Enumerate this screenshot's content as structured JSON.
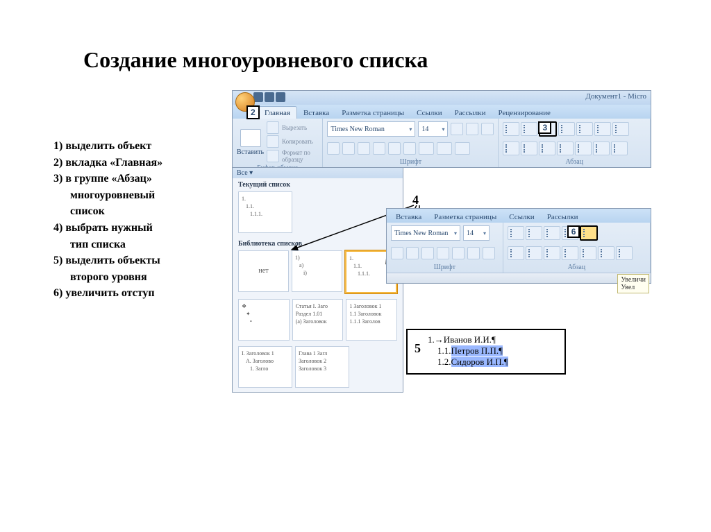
{
  "title": "Создание многоуровневого списка",
  "steps": {
    "s1": "1) выделить объект",
    "s2": "2) вкладка «Главная»",
    "s3": "3) в группе «Абзац»",
    "s3b": "многоуровневый",
    "s3c": "список",
    "s4": "4) выбрать нужный",
    "s4b": "тип списка",
    "s5": "5) выделить объекты",
    "s5b": "второго уровня",
    "s6": "6) увеличить отступ"
  },
  "ribbon": {
    "doc_title": "Документ1 - Micro",
    "tabs": {
      "home": "Главная",
      "insert": "Вставка",
      "layout": "Разметка страницы",
      "refs": "Ссылки",
      "mail": "Рассылки",
      "review": "Рецензирование"
    },
    "groups": {
      "clipboard": {
        "label": "Буфер обмена",
        "paste": "Вставить",
        "cut": "Вырезать",
        "copy": "Копировать",
        "format": "Формат по образцу"
      },
      "font": {
        "label": "Шрифт",
        "family": "Times New Roman",
        "size": "14"
      },
      "paragraph": {
        "label": "Абзац"
      }
    }
  },
  "dropdown": {
    "all": "Все ▾",
    "current": "Текущий список",
    "library": "Библиотека списков",
    "thumbs": {
      "t1a": "1.",
      "t1b": "1.1.",
      "t1c": "1.1.1.",
      "none": "нет",
      "t2a": "1)",
      "t2b": "a)",
      "t2c": "i)",
      "t3a": "1.",
      "t3b": "1.1.",
      "t3c": "1.1.1.",
      "t4a": "❖",
      "t4b": "✦",
      "t4c": "•",
      "t5a": "Статья I. Заго",
      "t5b": "Раздел 1.01",
      "t5c": "(a) Заголовок",
      "t6a": "1 Заголовок 1",
      "t6b": "1.1 Заголовок",
      "t6c": "1.1.1 Заголов",
      "t7a": "I. Заголовок 1",
      "t7b": "A. Заголово",
      "t7c": "1. Загло",
      "t8a": "Глава 1 Загл",
      "t8b": "Заголовок 2",
      "t8c": "Заголовок 3"
    }
  },
  "callouts": {
    "c2": "2",
    "c3": "3",
    "c4": "4",
    "c5": "5",
    "c6": "6"
  },
  "ribbon2": {
    "tooltip1": "Увеличи",
    "tooltip2": "Увел"
  },
  "example5": {
    "l1": "1.→Иванов И.И.¶",
    "l2_pre": "1.1.",
    "l2_sel": "Петров П.П.¶",
    "l3_pre": "1.2.",
    "l3_sel": "Сидоров И.П.¶"
  }
}
